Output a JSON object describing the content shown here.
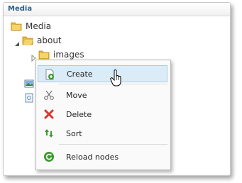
{
  "panel": {
    "title": "Media"
  },
  "tree": {
    "root": {
      "label": "Media",
      "icon": "folder-icon"
    },
    "about": {
      "label": "about",
      "icon": "folder-open-icon",
      "expander": "expanded-arrow-icon"
    },
    "images": {
      "label": "images",
      "icon": "folder-icon",
      "expander": "collapsed-arrow-icon"
    }
  },
  "context_menu": {
    "items": [
      {
        "label": "Create",
        "icon": "create-page-icon",
        "highlighted": true
      },
      {
        "label": "Move",
        "icon": "scissors-icon"
      },
      {
        "label": "Delete",
        "icon": "delete-x-icon"
      },
      {
        "label": "Sort",
        "icon": "sort-arrows-icon"
      },
      {
        "label": "Reload nodes",
        "icon": "reload-icon"
      }
    ]
  },
  "colors": {
    "title": "#2c5f86",
    "highlight": "#dcecf6",
    "folder": "#e8b93c",
    "delete": "#d9342b",
    "sort": "#3a9a2e"
  }
}
